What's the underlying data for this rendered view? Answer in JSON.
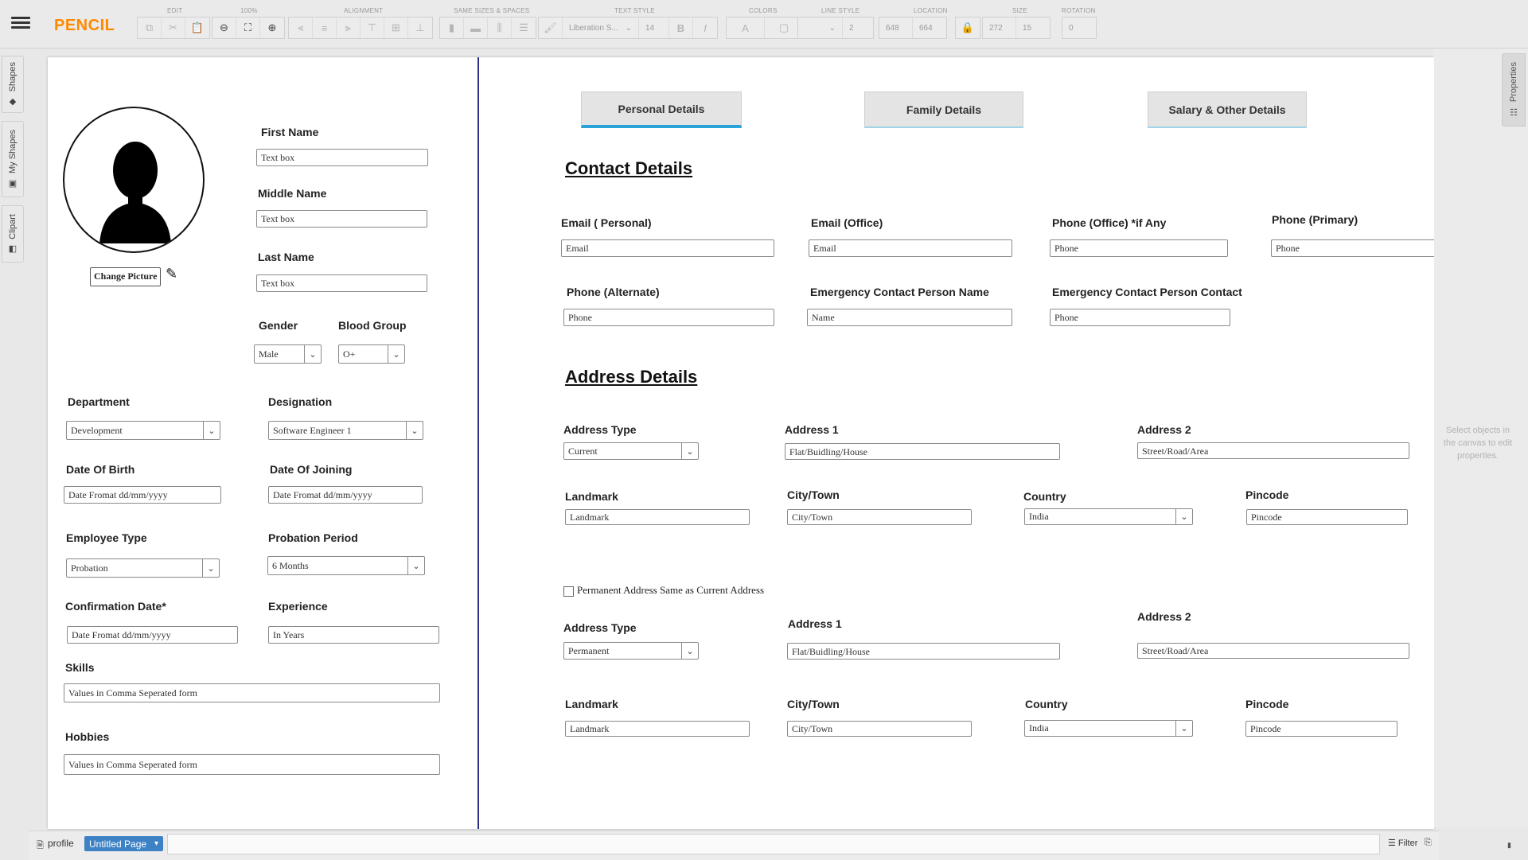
{
  "app": {
    "logo": "PENCIL",
    "group_labels": [
      "EDIT",
      "100%",
      "ALIGNMENT",
      "SAME SIZES & SPACES",
      "TEXT STYLE",
      "COLORS",
      "LINE STYLE",
      "LOCATION",
      "SIZE",
      "ROTATION"
    ],
    "text_font": "Liberation S...",
    "font_size": "14",
    "line_width": "2",
    "location_x": "648",
    "location_y": "664",
    "size_w": "272",
    "size_h": "15",
    "rotation": "0"
  },
  "sidebar": {
    "tabs": [
      "Shapes",
      "My Shapes",
      "Clipart"
    ]
  },
  "properties": {
    "tab_label": "Properties",
    "hint": "Select objects in the canvas to edit properties."
  },
  "bottom": {
    "doc_name": "profile",
    "page_name": "Untitled Page",
    "filter_label": "Filter"
  },
  "profile": {
    "change_picture": "Change Picture",
    "first_name_label": "First Name",
    "first_name_value": "Text box",
    "middle_name_label": "Middle Name",
    "middle_name_value": "Text box",
    "last_name_label": "Last Name",
    "last_name_value": "Text box",
    "gender_label": "Gender",
    "gender_value": "Male",
    "blood_group_label": "Blood Group",
    "blood_group_value": "O+",
    "department_label": "Department",
    "department_value": "Development",
    "designation_label": "Designation",
    "designation_value": "Software Engineer 1",
    "dob_label": "Date Of Birth",
    "dob_value": "Date Fromat dd/mm/yyyy",
    "doj_label": "Date Of Joining",
    "doj_value": "Date Fromat dd/mm/yyyy",
    "emp_type_label": "Employee Type",
    "emp_type_value": "Probation",
    "probation_label": "Probation Period",
    "probation_value": "6 Months",
    "confirm_label": "Confirmation Date*",
    "confirm_value": "Date Fromat dd/mm/yyyy",
    "experience_label": "Experience",
    "experience_value": "In Years",
    "skills_label": "Skills",
    "skills_value": "Values in Comma Seperated form",
    "hobbies_label": "Hobbies",
    "hobbies_value": "Values in Comma Seperated form"
  },
  "tabs": [
    "Personal Details",
    "Family Details",
    "Salary & Other Details"
  ],
  "contact": {
    "heading": "Contact Details",
    "email_personal_label": "Email ( Personal)",
    "email_personal_value": "Email",
    "email_office_label": "Email (Office)",
    "email_office_value": "Email",
    "phone_office_label": "Phone (Office) *if Any",
    "phone_office_value": "Phone",
    "phone_primary_label": "Phone (Primary)",
    "phone_primary_value": "Phone",
    "phone_alt_label": "Phone (Alternate)",
    "phone_alt_value": "Phone",
    "emergency_name_label": "Emergency Contact Person Name",
    "emergency_name_value": "Name",
    "emergency_contact_label": "Emergency Contact Person Contact",
    "emergency_contact_value": "Phone"
  },
  "address": {
    "heading": "Address Details",
    "current": {
      "type_label": "Address Type",
      "type_value": "Current",
      "addr1_label": "Address 1",
      "addr1_value": "Flat/Buidling/House",
      "addr2_label": "Address 2",
      "addr2_value": "Street/Road/Area",
      "landmark_label": "Landmark",
      "landmark_value": "Landmark",
      "city_label": "City/Town",
      "city_value": "City/Town",
      "country_label": "Country",
      "country_value": "India",
      "pincode_label": "Pincode",
      "pincode_value": "Pincode"
    },
    "same_checkbox_label": "Permanent Address Same as Current Address",
    "permanent": {
      "type_label": "Address Type",
      "type_value": "Permanent",
      "addr1_label": "Address 1",
      "addr1_value": "Flat/Buidling/House",
      "addr2_label": "Address 2",
      "addr2_value": "Street/Road/Area",
      "landmark_label": "Landmark",
      "landmark_value": "Landmark",
      "city_label": "City/Town",
      "city_value": "City/Town",
      "country_label": "Country",
      "country_value": "India",
      "pincode_label": "Pincode",
      "pincode_value": "Pincode"
    }
  },
  "colors": {
    "logo": "#ff8a00",
    "divider": "#2b2f8a",
    "active_tab_underline": "#2aa3d8",
    "page_tab": "#3d82c4"
  }
}
